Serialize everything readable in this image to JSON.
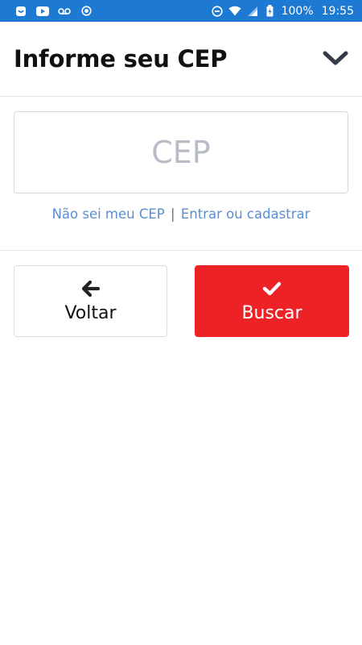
{
  "status_bar": {
    "battery": "100%",
    "time": "19:55",
    "icons": [
      "notification-app-icon",
      "youtube-icon",
      "voicemail-icon",
      "record-icon",
      "do-not-disturb-icon",
      "wifi-icon",
      "signal-icon",
      "battery-icon"
    ],
    "background": "#1e79d2"
  },
  "header": {
    "title": "Informe seu CEP",
    "toggle_icon": "chevron-down-icon"
  },
  "cep": {
    "placeholder": "CEP",
    "value": "",
    "link_unknown": "Não sei meu CEP",
    "separator": "|",
    "link_login": "Entrar ou cadastrar"
  },
  "actions": {
    "back_label": "Voltar",
    "back_icon": "arrow-left-icon",
    "search_label": "Buscar",
    "search_icon": "check-icon",
    "search_color": "#ec2226"
  }
}
